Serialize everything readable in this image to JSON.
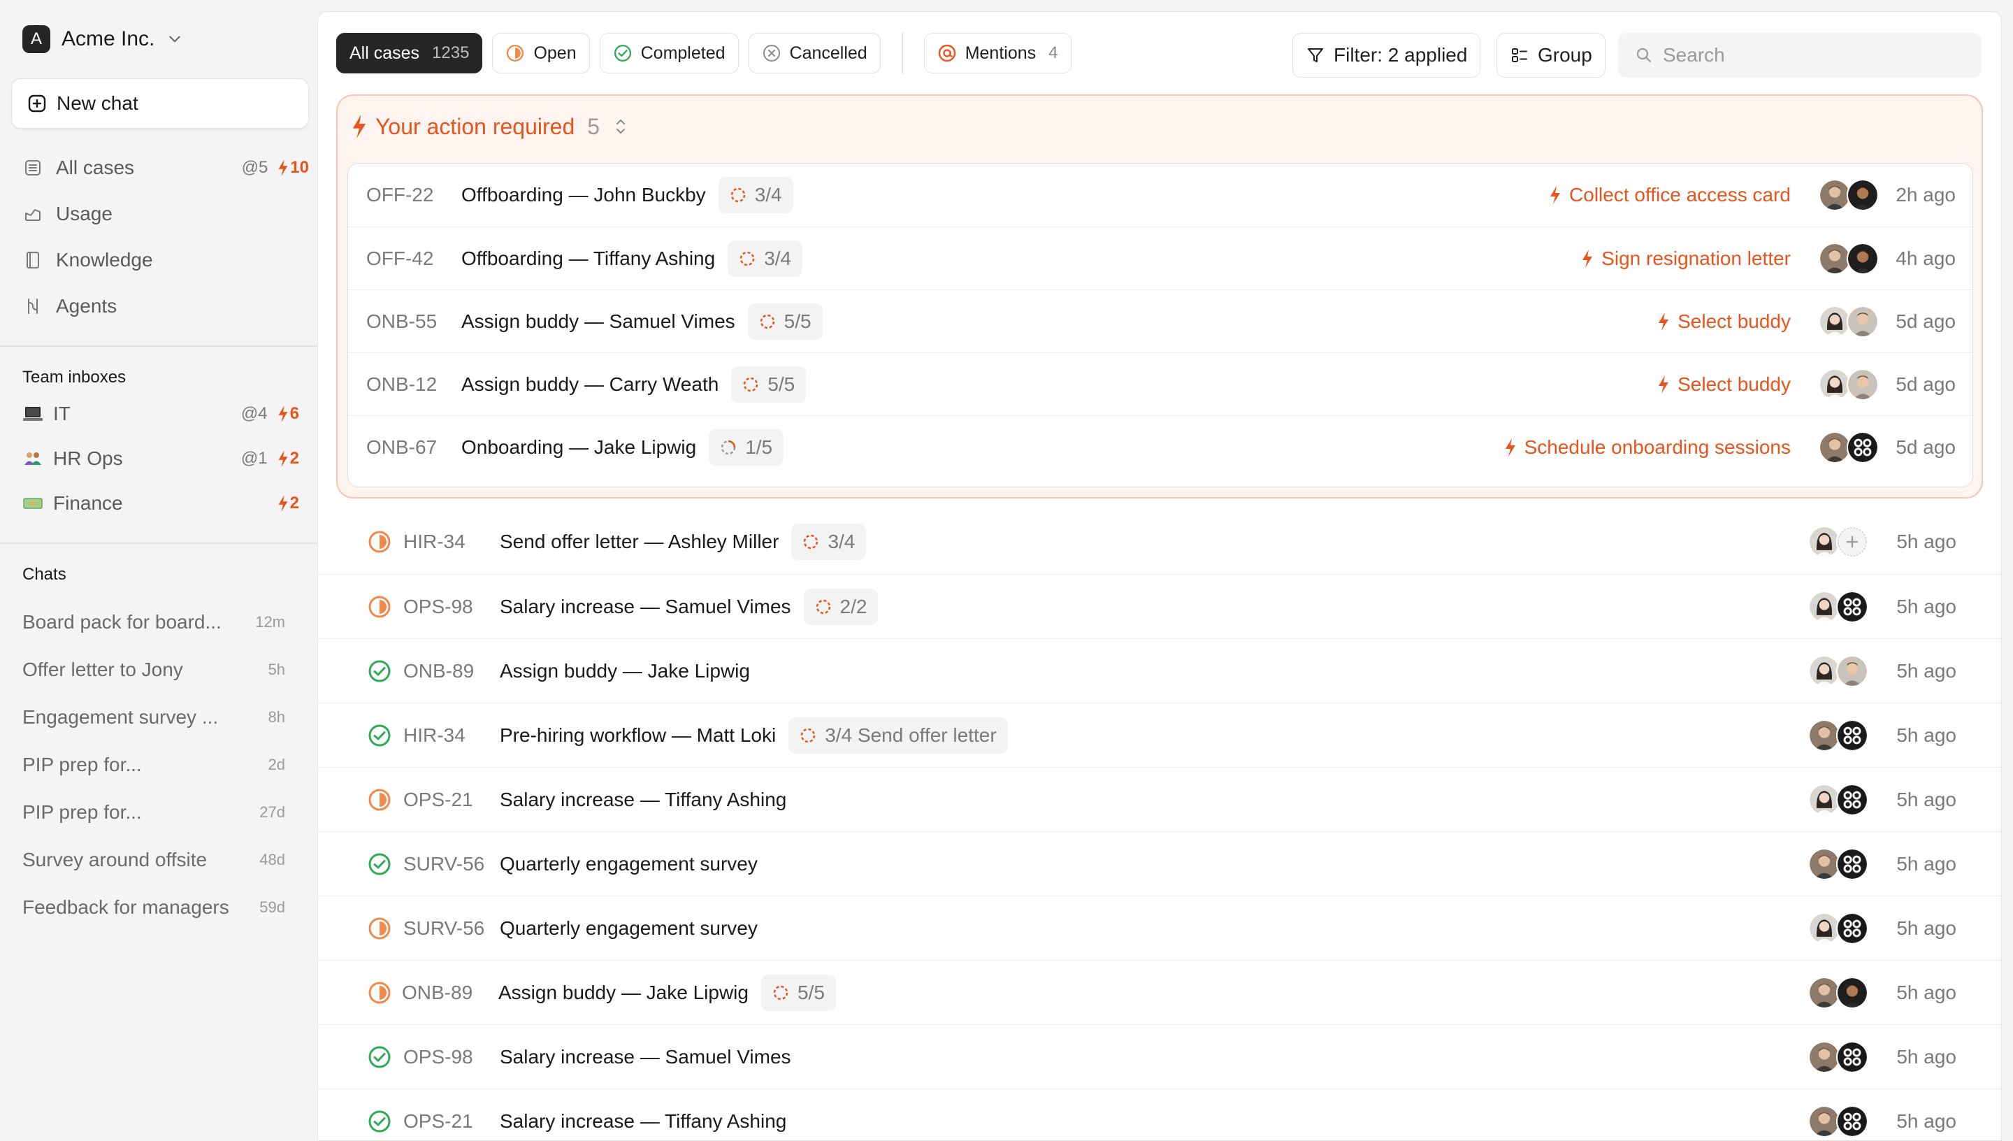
{
  "workspace": {
    "initial": "A",
    "name": "Acme Inc."
  },
  "new_chat_label": "New chat",
  "nav": [
    {
      "label": "All cases",
      "mentions": "@5",
      "actions": "10",
      "icon": "list-icon"
    },
    {
      "label": "Usage",
      "icon": "chart-icon"
    },
    {
      "label": "Knowledge",
      "icon": "book-icon"
    },
    {
      "label": "Agents",
      "icon": "agents-icon"
    }
  ],
  "team_inboxes_title": "Team inboxes",
  "team_inboxes": [
    {
      "label": "IT",
      "mentions": "@4",
      "actions": "6",
      "icon": "laptop-icon"
    },
    {
      "label": "HR Ops",
      "mentions": "@1",
      "actions": "2",
      "icon": "people-icon"
    },
    {
      "label": "Finance",
      "mentions": "",
      "actions": "2",
      "icon": "money-icon"
    }
  ],
  "chats_title": "Chats",
  "chats": [
    {
      "title": "Board pack for board...",
      "age": "12m"
    },
    {
      "title": "Offer letter to Jony",
      "age": "5h"
    },
    {
      "title": "Engagement survey ...",
      "age": "8h"
    },
    {
      "title": "PIP prep for...",
      "age": "2d"
    },
    {
      "title": "PIP prep for...",
      "age": "27d"
    },
    {
      "title": "Survey around offsite",
      "age": "48d"
    },
    {
      "title": "Feedback for managers",
      "age": "59d"
    }
  ],
  "tabs": [
    {
      "label": "All cases",
      "count": "1235"
    },
    {
      "label": "Open",
      "count": ""
    },
    {
      "label": "Completed",
      "count": ""
    },
    {
      "label": "Cancelled",
      "count": ""
    },
    {
      "label": "Mentions",
      "count": "4"
    }
  ],
  "toolbar": {
    "filter_label": "Filter: 2 applied",
    "group_label": "Group",
    "search_placeholder": "Search"
  },
  "colors": {
    "accent": "#e8541b",
    "success": "#2eaa58",
    "open": "#f08a4b",
    "dark": "#262626"
  },
  "action_required": {
    "title": "Your action required",
    "count": "5",
    "rows": [
      {
        "id": "OFF-22",
        "title": "Offboarding — John Buckby",
        "progress": "3/4",
        "action": "Collect office access card",
        "time": "2h ago"
      },
      {
        "id": "OFF-42",
        "title": "Offboarding — Tiffany Ashing",
        "progress": "3/4",
        "action": "Sign resignation letter",
        "time": "4h ago"
      },
      {
        "id": "ONB-55",
        "title": "Assign buddy — Samuel Vimes",
        "progress": "5/5",
        "action": "Select buddy",
        "time": "5d ago"
      },
      {
        "id": "ONB-12",
        "title": "Assign buddy — Carry Weath",
        "progress": "5/5",
        "action": "Select buddy",
        "time": "5d ago"
      },
      {
        "id": "ONB-67",
        "title": "Onboarding — Jake Lipwig",
        "progress": "1/5",
        "action": "Schedule onboarding sessions",
        "time": "5d ago"
      }
    ]
  },
  "cases": [
    {
      "status": "open",
      "id": "HIR-34",
      "title": "Send offer letter — Ashley Miller",
      "progress": "3/4",
      "time": "5h ago"
    },
    {
      "status": "open",
      "id": "OPS-98",
      "title": "Salary increase — Samuel Vimes",
      "progress": "2/2",
      "time": "5h ago"
    },
    {
      "status": "completed",
      "id": "ONB-89",
      "title": "Assign buddy — Jake Lipwig",
      "progress": "",
      "time": "5h ago"
    },
    {
      "status": "completed",
      "id": "HIR-34",
      "title": "Pre-hiring workflow — Matt Loki",
      "progress": "3/4 Send offer letter",
      "time": "5h ago"
    },
    {
      "status": "open",
      "id": "OPS-21",
      "title": "Salary increase — Tiffany Ashing",
      "progress": "",
      "time": "5h ago"
    },
    {
      "status": "completed",
      "id": "SURV-56",
      "title": "Quarterly engagement survey",
      "progress": "",
      "time": "5h ago"
    },
    {
      "status": "open",
      "id": "SURV-56",
      "title": "Quarterly engagement survey",
      "progress": "",
      "time": "5h ago"
    },
    {
      "status": "open",
      "id": "ONB-89",
      "title": "Assign buddy — Jake Lipwig",
      "progress": "5/5",
      "time": "5h ago"
    },
    {
      "status": "completed",
      "id": "OPS-98",
      "title": "Salary increase — Samuel Vimes",
      "progress": "",
      "time": "5h ago"
    },
    {
      "status": "completed",
      "id": "OPS-21",
      "title": "Salary increase — Tiffany Ashing",
      "progress": "",
      "time": "5h ago"
    }
  ]
}
